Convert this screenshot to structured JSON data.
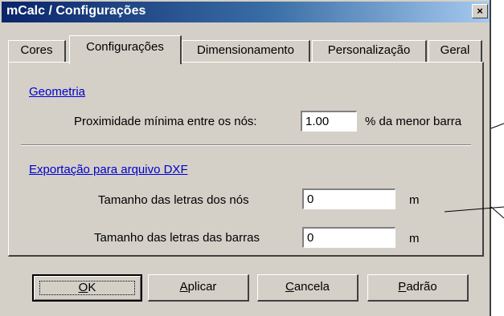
{
  "window": {
    "title": "mCalc / Configurações",
    "close_glyph": "×"
  },
  "tabs": [
    {
      "label": "Cores",
      "active": false
    },
    {
      "label": "Configurações",
      "active": true
    },
    {
      "label": "Dimensionamento",
      "active": false
    },
    {
      "label": "Personalização",
      "active": false
    },
    {
      "label": "Geral",
      "active": false
    }
  ],
  "geometria": {
    "heading": "Geometria",
    "min_proximity_label": "Proximidade mínima entre os nós:",
    "min_proximity_value": "1.00",
    "min_proximity_unit": "% da menor barra"
  },
  "dxf": {
    "heading": "Exportação para arquivo DXF",
    "node_letter_label": "Tamanho das letras dos nós",
    "node_letter_value": "0",
    "node_letter_unit": "m",
    "bar_letter_label": "Tamanho das letras das barras",
    "bar_letter_value": "0",
    "bar_letter_unit": "m"
  },
  "buttons": {
    "ok_mnemonic": "O",
    "ok_rest": "K",
    "apply_mnemonic": "A",
    "apply_rest": "plicar",
    "cancel_mnemonic": "C",
    "cancel_rest": "ancela",
    "default_mnemonic": "P",
    "default_rest": "adrão"
  }
}
